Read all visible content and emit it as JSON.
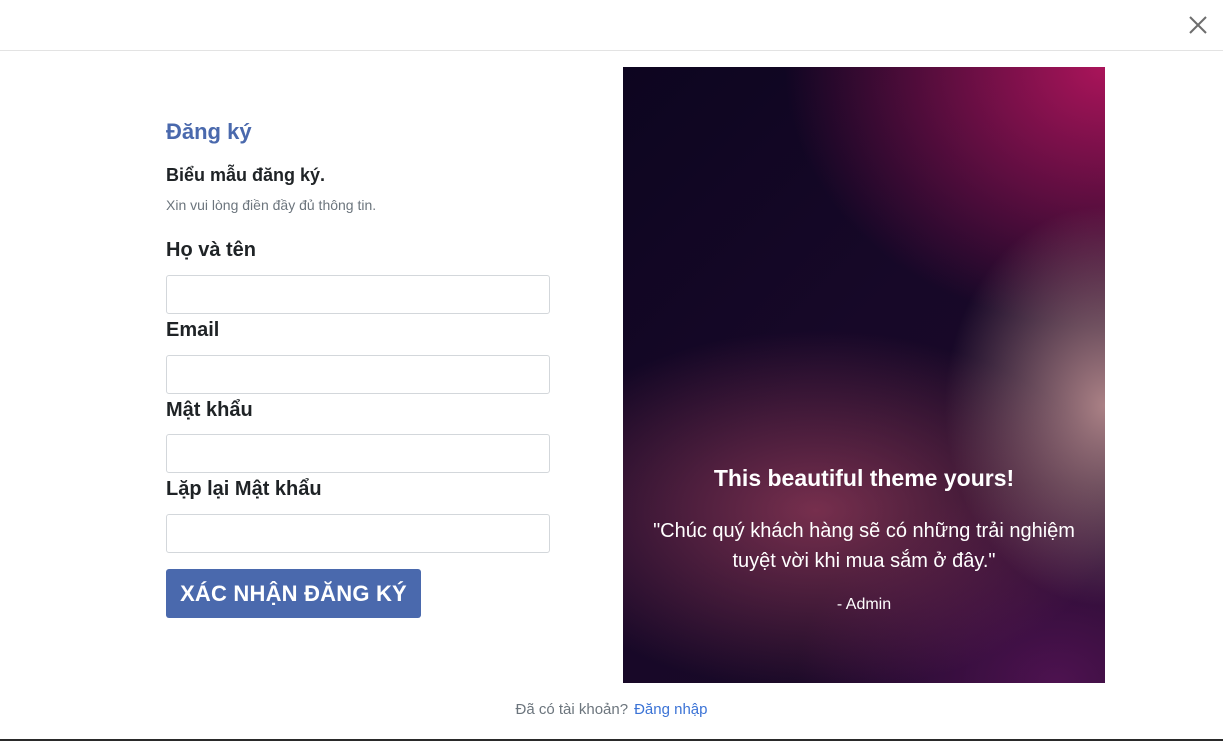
{
  "form": {
    "title": "Đăng ký",
    "subtitle": "Biểu mẫu đăng ký.",
    "hint": "Xin vui lòng điền đầy đủ thông tin.",
    "fields": [
      {
        "label": "Họ và tên",
        "value": "",
        "placeholder": ""
      },
      {
        "label": "Email",
        "value": "",
        "placeholder": ""
      },
      {
        "label": "Mật khẩu",
        "value": "",
        "placeholder": ""
      },
      {
        "label": "Lặp lại Mật khẩu",
        "value": "",
        "placeholder": ""
      }
    ],
    "submit_label": "XÁC NHẬN ĐĂNG KÝ"
  },
  "promo": {
    "title": "This beautiful theme yours!",
    "quote": "\"Chúc quý khách hàng sẽ có những trải nghiệm tuyệt vời khi mua sắm ở đây.\"",
    "author": "- Admin"
  },
  "footer": {
    "prompt": "Đã có tài khoản?",
    "login_link": "Đăng nhập"
  },
  "icons": {
    "close": "close-icon"
  },
  "colors": {
    "accent": "#4a69ad",
    "link": "#3b73d6",
    "muted": "#6c757d"
  }
}
